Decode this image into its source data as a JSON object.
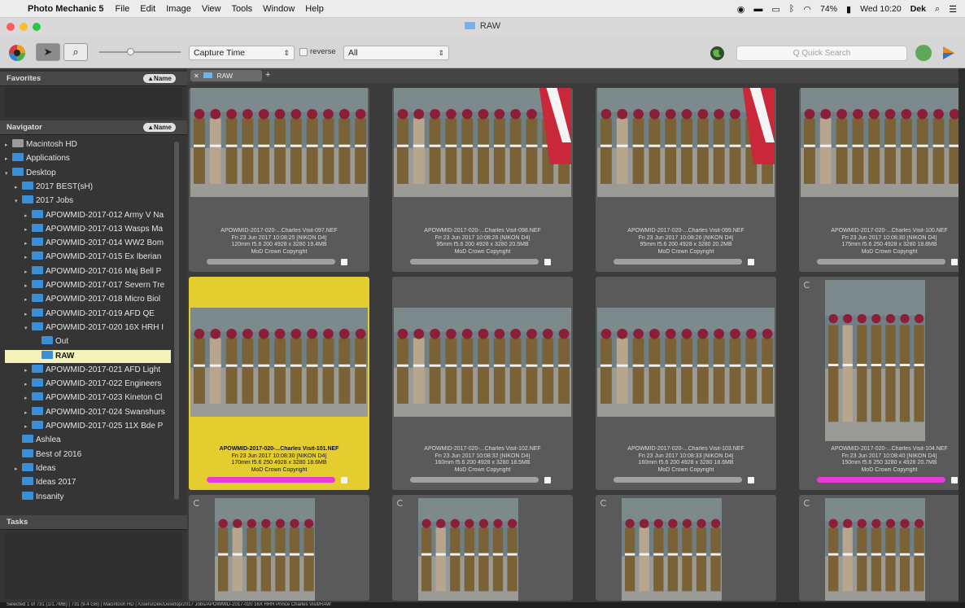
{
  "menubar": {
    "app_name": "Photo Mechanic 5",
    "items": [
      "File",
      "Edit",
      "Image",
      "View",
      "Tools",
      "Window",
      "Help"
    ],
    "battery": "74%",
    "clock": "Wed 10:20",
    "user": "Dek"
  },
  "window": {
    "title": "RAW"
  },
  "toolbar": {
    "sort_value": "Capture Time",
    "reverse_label": "reverse",
    "filter_value": "All",
    "search_placeholder": "Q Quick Search"
  },
  "favorites": {
    "title": "Favorites",
    "button": "▲Name"
  },
  "navigator": {
    "title": "Navigator",
    "button": "▲Name",
    "items": [
      {
        "label": "Macintosh HD"
      },
      {
        "label": "Applications"
      },
      {
        "label": "Desktop"
      },
      {
        "label": "2017 BEST(sH)"
      },
      {
        "label": "2017 Jobs"
      },
      {
        "label": "APOWMID-2017-012 Army V Na"
      },
      {
        "label": "APOWMID-2017-013 Wasps Ma"
      },
      {
        "label": "APOWMID-2017-014 WW2 Bom"
      },
      {
        "label": "APOWMID-2017-015 Ex Iberian"
      },
      {
        "label": "APOWMID-2017-016 Maj Bell P"
      },
      {
        "label": "APOWMID-2017-017 Severn Tre"
      },
      {
        "label": "APOWMID-2017-018 Micro Biol"
      },
      {
        "label": "APOWMID-2017-019 AFD QE"
      },
      {
        "label": "APOWMID-2017-020 16X HRH I"
      },
      {
        "label": "Out"
      },
      {
        "label": "RAW"
      },
      {
        "label": "APOWMID-2017-021 AFD Light"
      },
      {
        "label": "APOWMID-2017-022 Engineers"
      },
      {
        "label": "APOWMID-2017-023 Kineton Cl"
      },
      {
        "label": "APOWMID-2017-024 Swanshurs"
      },
      {
        "label": "APOWMID-2017-025 11X Bde P"
      },
      {
        "label": "Ashlea"
      },
      {
        "label": "Best of 2016"
      },
      {
        "label": "Ideas"
      },
      {
        "label": "Ideas 2017"
      },
      {
        "label": "Insanity"
      }
    ]
  },
  "tasks": {
    "title": "Tasks"
  },
  "browser_tab": {
    "label": "RAW"
  },
  "thumbnails": [
    {
      "filename": "APOWMID-2017-020-...Charles Visit-097.NEF",
      "date": "Fri 23 Jun 2017  10:08:25  [NIKON D4]",
      "specs": "120mm f5.6 200  4928 x 3280  19.4MB",
      "copyright": "MoD Crown Copyright"
    },
    {
      "filename": "APOWMID-2017-020-...Charles Visit-098.NEF",
      "date": "Fri 23 Jun 2017  10:08:26  [NIKON D4]",
      "specs": "95mm f5.6 200  4928 x 3280  20.5MB",
      "copyright": "MoD Crown Copyright"
    },
    {
      "filename": "APOWMID-2017-020-...Charles Visit-099.NEF",
      "date": "Fri 23 Jun 2017  10:08:26  [NIKON D4]",
      "specs": "95mm f5.6 200  4928 x 3280  20.2MB",
      "copyright": "MoD Crown Copyright"
    },
    {
      "filename": "APOWMID-2017-020-...Charles Visit-100.NEF",
      "date": "Fri 23 Jun 2017  10:08:30  [NIKON D4]",
      "specs": "175mm f5.6 250  4928 x 3280  18.8MB",
      "copyright": "MoD Crown Copyright"
    },
    {
      "filename": "APOWMID-2017-020-...Charles Visit-101.NEF",
      "date": "Fri 23 Jun 2017  10:08:30  [NIKON D4]",
      "specs": "170mm f5.6 250  4928 x 3280  18.6MB",
      "copyright": "MoD Crown Copyright"
    },
    {
      "filename": "APOWMID-2017-020-...Charles Visit-102.NEF",
      "date": "Fri 23 Jun 2017  10:08:32  [NIKON D4]",
      "specs": "160mm f5.6 200  4928 x 3280  18.5MB",
      "copyright": "MoD Crown Copyright"
    },
    {
      "filename": "APOWMID-2017-020-...Charles Visit-103.NEF",
      "date": "Fri 23 Jun 2017  10:08:33  [NIKON D4]",
      "specs": "160mm f5.6 200  4928 x 3280  18.6MB",
      "copyright": "MoD Crown Copyright"
    },
    {
      "filename": "APOWMID-2017-020-...Charles Visit-104.NEF",
      "date": "Fri 23 Jun 2017  10:08:40  [NIKON D4]",
      "specs": "150mm f5.6 250  3280 x 4928  20.7MB",
      "copyright": "MoD Crown Copyright"
    },
    {
      "filename": "",
      "date": "",
      "specs": "",
      "copyright": ""
    },
    {
      "filename": "",
      "date": "",
      "specs": "",
      "copyright": ""
    },
    {
      "filename": "",
      "date": "",
      "specs": "",
      "copyright": ""
    },
    {
      "filename": "",
      "date": "",
      "specs": "",
      "copyright": ""
    }
  ],
  "status": {
    "text": "Selected 1 of 731 (1/1.7MB) | 731 (9.4 GB) | Macintosh HD | /Users/Dek/Desktop/2017 Jobs/APOWMID-2017-020 16X HRH Prince Charles Visit/RAW"
  },
  "colors": {
    "selected": "#e4cd2f",
    "tag": "#e93bd9",
    "folder": "#3b8fd6"
  }
}
